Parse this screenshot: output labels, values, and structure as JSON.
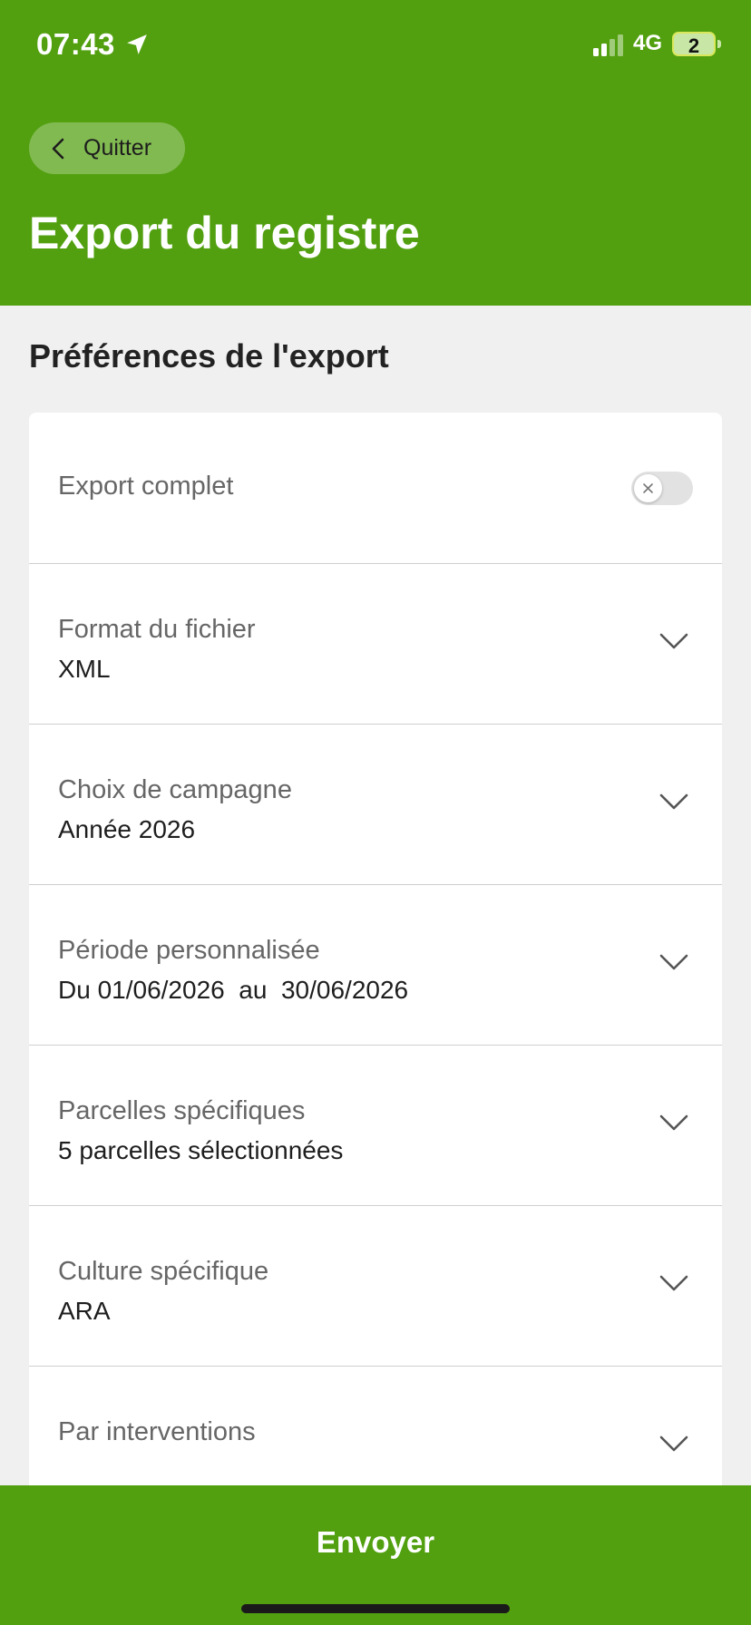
{
  "status_bar": {
    "time": "07:43",
    "network": "4G",
    "battery": "2"
  },
  "header": {
    "back_label": "Quitter",
    "title": "Export du registre"
  },
  "section": {
    "title": "Préférences de l'export"
  },
  "export_complet": {
    "label": "Export complet",
    "enabled": false
  },
  "fields": [
    {
      "label": "Format du fichier",
      "value": "XML"
    },
    {
      "label": "Choix de campagne",
      "value": "Année 2026"
    },
    {
      "label": "Période personnalisée",
      "value": "Du 01/06/2026  au  30/06/2026"
    },
    {
      "label": "Parcelles spécifiques",
      "value": "5 parcelles sélectionnées"
    },
    {
      "label": "Culture spécifique",
      "value": "ARA"
    },
    {
      "label": "Par interventions",
      "value": ""
    }
  ],
  "footer": {
    "send_label": "Envoyer"
  },
  "colors": {
    "brand": "#52a010",
    "background": "#f0f0f0",
    "card": "#ffffff"
  }
}
